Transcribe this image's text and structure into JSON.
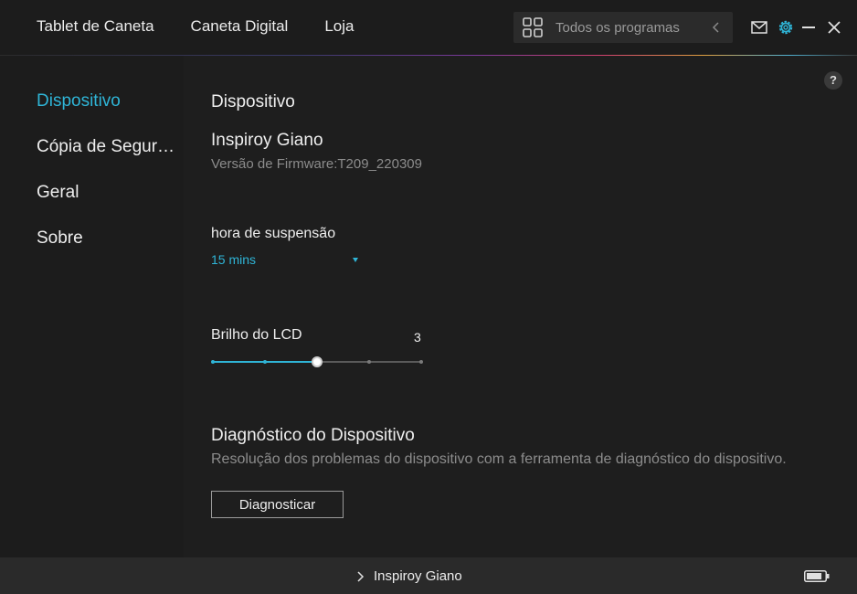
{
  "topnav": {
    "items": [
      "Tablet de Caneta",
      "Caneta Digital",
      "Loja"
    ]
  },
  "search": {
    "placeholder": "Todos os programas"
  },
  "sidebar": {
    "items": [
      {
        "label": "Dispositivo",
        "active": true
      },
      {
        "label": "Cópia de Segura...",
        "active": false
      },
      {
        "label": "Geral",
        "active": false
      },
      {
        "label": "Sobre",
        "active": false
      }
    ]
  },
  "main": {
    "section_title": "Dispositivo",
    "device_name": "Inspiroy Giano",
    "firmware": "Versão de Firmware:T209_220309",
    "sleep": {
      "label": "hora de suspensão",
      "value": "15 mins"
    },
    "lcd": {
      "label": "Brilho do LCD",
      "value": "3",
      "level": 3,
      "levels": 5
    },
    "diagnostics": {
      "title": "Diagnóstico do Dispositivo",
      "description": "Resolução dos problemas do dispositivo com a ferramenta de diagnóstico do dispositivo.",
      "button_label": "Diagnosticar"
    },
    "help_label": "?"
  },
  "bottombar": {
    "device_name": "Inspiroy Giano",
    "battery_level": 0.85
  },
  "colors": {
    "accent": "#2fb4d6",
    "background": "#1e1e1e",
    "sidebar": "#1c1c1c",
    "bottombar": "#2a2a2a"
  },
  "icons": [
    "apps-grid-icon",
    "chevron-left-icon",
    "mail-icon",
    "gear-icon",
    "minimize-icon",
    "close-icon",
    "help-icon",
    "dropdown-caret-icon",
    "chevron-right-icon",
    "battery-icon"
  ]
}
